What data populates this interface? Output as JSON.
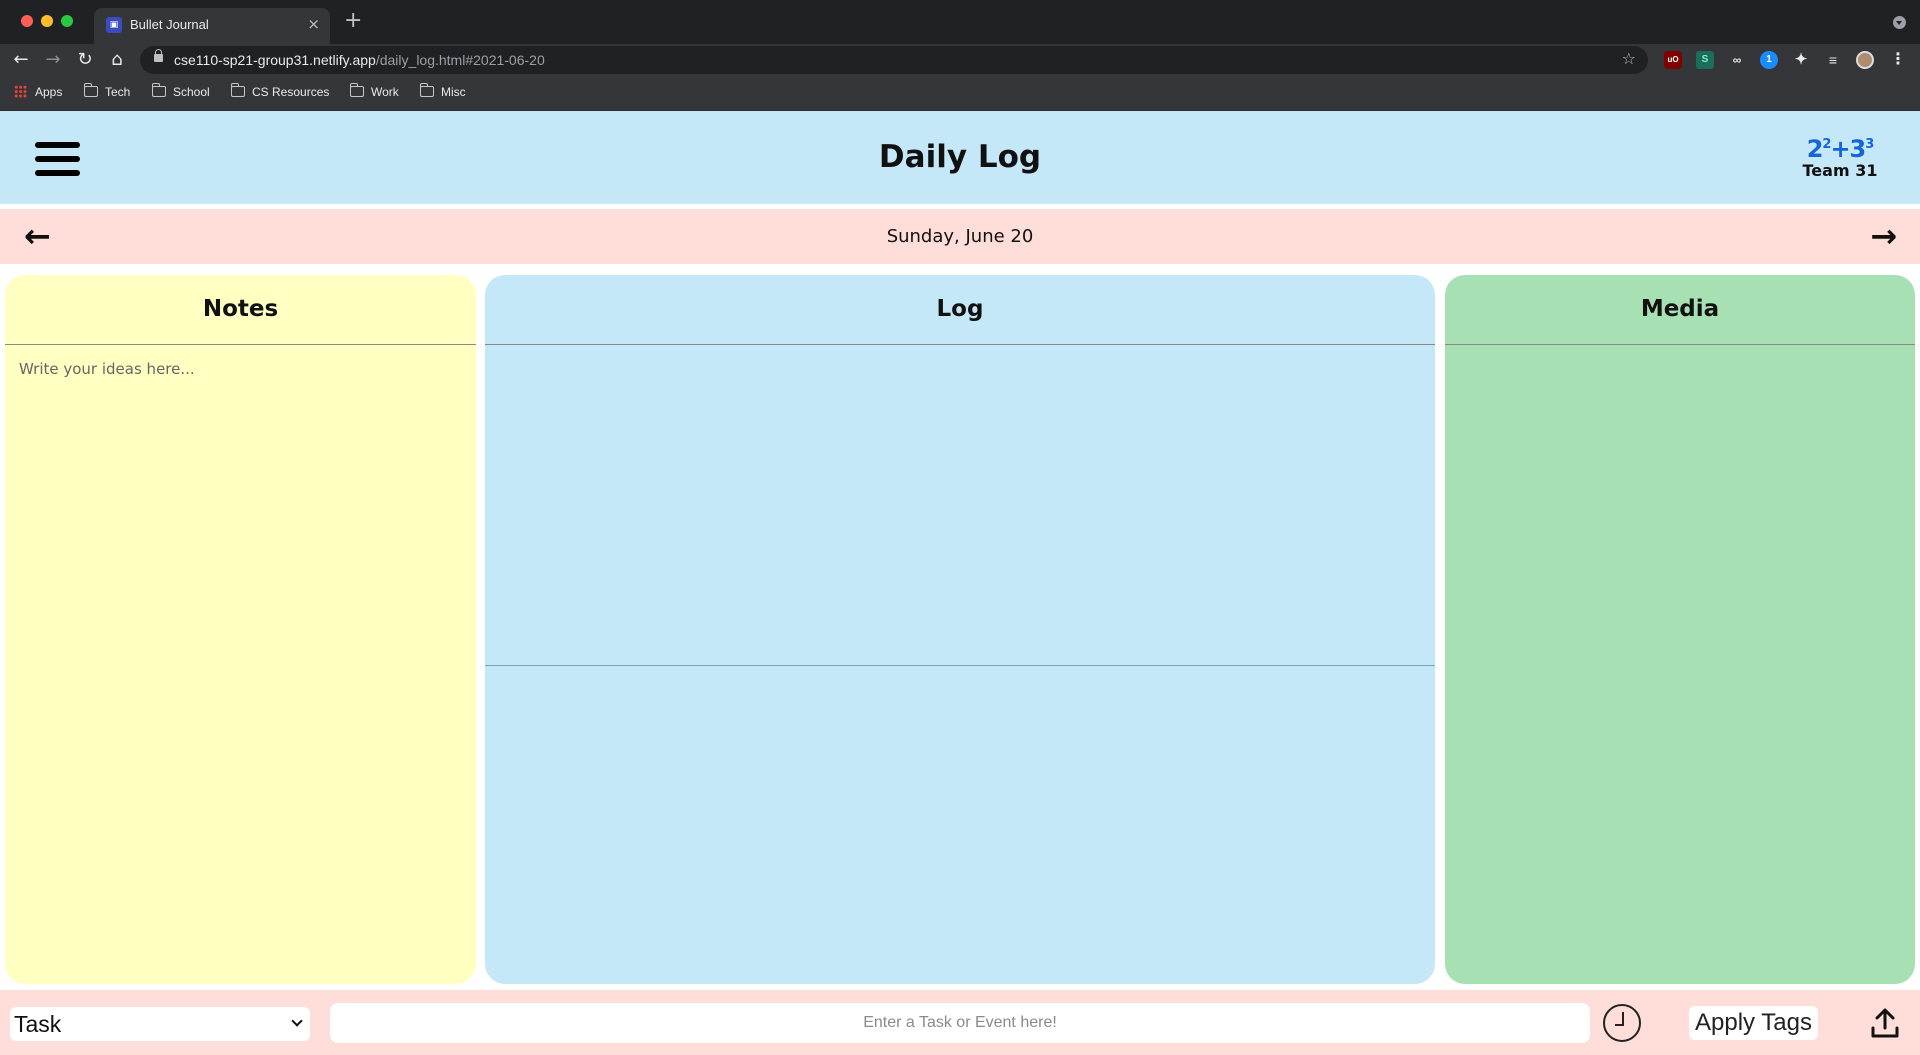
{
  "browser": {
    "tab_title": "Bullet Journal",
    "tab_close": "×",
    "new_tab": "+",
    "url_host": "cse110-sp21-group31.netlify.app",
    "url_path": "/daily_log.html#2021-06-20",
    "bookmarks": [
      "Apps",
      "Tech",
      "School",
      "CS Resources",
      "Work",
      "Misc"
    ]
  },
  "header": {
    "title": "Daily Log",
    "logo_text": "Team 31"
  },
  "date_nav": {
    "date": "Sunday, June 20"
  },
  "panels": {
    "notes": {
      "title": "Notes",
      "placeholder": "Write your ideas here..."
    },
    "log": {
      "title": "Log"
    },
    "media": {
      "title": "Media"
    }
  },
  "bottom_bar": {
    "entry_type": "Task",
    "entry_placeholder": "Enter a Task or Event here!",
    "apply_tags": "Apply Tags"
  },
  "colors": {
    "header_bg": "#c4e8f8",
    "date_bar_bg": "#ffddd9",
    "notes_bg": "#ffffc2",
    "log_bg": "#c4e8f8",
    "media_bg": "#a7e1b3",
    "logo_blue": "#1565d8"
  },
  "icons": [
    "menu-icon",
    "arrow-left-icon",
    "arrow-right-icon",
    "clock-icon",
    "upload-icon"
  ]
}
